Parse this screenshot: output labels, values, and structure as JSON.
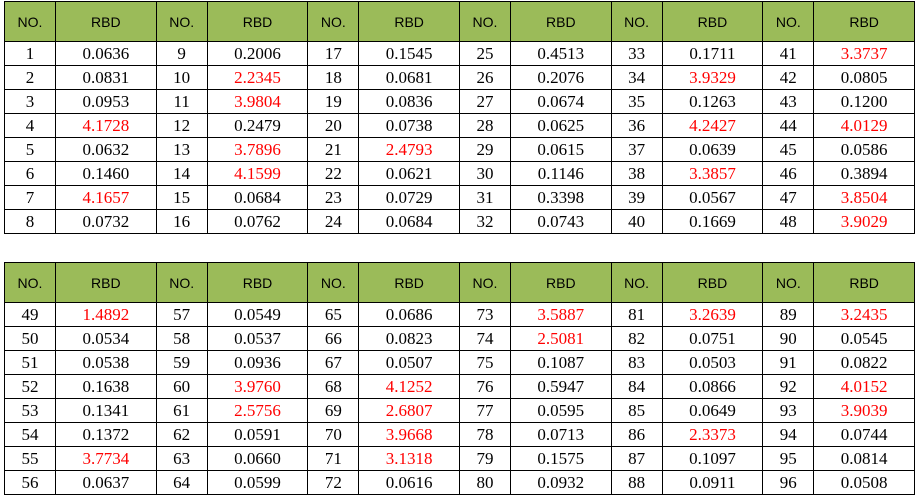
{
  "tables": [
    {
      "headers": [
        "NO.",
        "RBD",
        "NO.",
        "RBD",
        "NO.",
        "RBD",
        "NO.",
        "RBD",
        "NO.",
        "RBD",
        "NO.",
        "RBD"
      ],
      "rows": [
        [
          {
            "no": "1",
            "rbd": "0.0636",
            "hi": false
          },
          {
            "no": "9",
            "rbd": "0.2006",
            "hi": false
          },
          {
            "no": "17",
            "rbd": "0.1545",
            "hi": false
          },
          {
            "no": "25",
            "rbd": "0.4513",
            "hi": false
          },
          {
            "no": "33",
            "rbd": "0.1711",
            "hi": false
          },
          {
            "no": "41",
            "rbd": "3.3737",
            "hi": true
          }
        ],
        [
          {
            "no": "2",
            "rbd": "0.0831",
            "hi": false
          },
          {
            "no": "10",
            "rbd": "2.2345",
            "hi": true
          },
          {
            "no": "18",
            "rbd": "0.0681",
            "hi": false
          },
          {
            "no": "26",
            "rbd": "0.2076",
            "hi": false
          },
          {
            "no": "34",
            "rbd": "3.9329",
            "hi": true
          },
          {
            "no": "42",
            "rbd": "0.0805",
            "hi": false
          }
        ],
        [
          {
            "no": "3",
            "rbd": "0.0953",
            "hi": false
          },
          {
            "no": "11",
            "rbd": "3.9804",
            "hi": true
          },
          {
            "no": "19",
            "rbd": "0.0836",
            "hi": false
          },
          {
            "no": "27",
            "rbd": "0.0674",
            "hi": false
          },
          {
            "no": "35",
            "rbd": "0.1263",
            "hi": false
          },
          {
            "no": "43",
            "rbd": "0.1200",
            "hi": false
          }
        ],
        [
          {
            "no": "4",
            "rbd": "4.1728",
            "hi": true
          },
          {
            "no": "12",
            "rbd": "0.2479",
            "hi": false
          },
          {
            "no": "20",
            "rbd": "0.0738",
            "hi": false
          },
          {
            "no": "28",
            "rbd": "0.0625",
            "hi": false
          },
          {
            "no": "36",
            "rbd": "4.2427",
            "hi": true
          },
          {
            "no": "44",
            "rbd": "4.0129",
            "hi": true
          }
        ],
        [
          {
            "no": "5",
            "rbd": "0.0632",
            "hi": false
          },
          {
            "no": "13",
            "rbd": "3.7896",
            "hi": true
          },
          {
            "no": "21",
            "rbd": "2.4793",
            "hi": true
          },
          {
            "no": "29",
            "rbd": "0.0615",
            "hi": false
          },
          {
            "no": "37",
            "rbd": "0.0639",
            "hi": false
          },
          {
            "no": "45",
            "rbd": "0.0586",
            "hi": false
          }
        ],
        [
          {
            "no": "6",
            "rbd": "0.1460",
            "hi": false
          },
          {
            "no": "14",
            "rbd": "4.1599",
            "hi": true
          },
          {
            "no": "22",
            "rbd": "0.0621",
            "hi": false
          },
          {
            "no": "30",
            "rbd": "0.1146",
            "hi": false
          },
          {
            "no": "38",
            "rbd": "3.3857",
            "hi": true
          },
          {
            "no": "46",
            "rbd": "0.3894",
            "hi": false
          }
        ],
        [
          {
            "no": "7",
            "rbd": "4.1657",
            "hi": true
          },
          {
            "no": "15",
            "rbd": "0.0684",
            "hi": false
          },
          {
            "no": "23",
            "rbd": "0.0729",
            "hi": false
          },
          {
            "no": "31",
            "rbd": "0.3398",
            "hi": false
          },
          {
            "no": "39",
            "rbd": "0.0567",
            "hi": false
          },
          {
            "no": "47",
            "rbd": "3.8504",
            "hi": true
          }
        ],
        [
          {
            "no": "8",
            "rbd": "0.0732",
            "hi": false
          },
          {
            "no": "16",
            "rbd": "0.0762",
            "hi": false
          },
          {
            "no": "24",
            "rbd": "0.0684",
            "hi": false
          },
          {
            "no": "32",
            "rbd": "0.0743",
            "hi": false
          },
          {
            "no": "40",
            "rbd": "0.1669",
            "hi": false
          },
          {
            "no": "48",
            "rbd": "3.9029",
            "hi": true
          }
        ]
      ]
    },
    {
      "headers": [
        "NO.",
        "RBD",
        "NO.",
        "RBD",
        "NO.",
        "RBD",
        "NO.",
        "RBD",
        "NO.",
        "RBD",
        "NO.",
        "RBD"
      ],
      "rows": [
        [
          {
            "no": "49",
            "rbd": "1.4892",
            "hi": true
          },
          {
            "no": "57",
            "rbd": "0.0549",
            "hi": false
          },
          {
            "no": "65",
            "rbd": "0.0686",
            "hi": false
          },
          {
            "no": "73",
            "rbd": "3.5887",
            "hi": true
          },
          {
            "no": "81",
            "rbd": "3.2639",
            "hi": true
          },
          {
            "no": "89",
            "rbd": "3.2435",
            "hi": true
          }
        ],
        [
          {
            "no": "50",
            "rbd": "0.0534",
            "hi": false
          },
          {
            "no": "58",
            "rbd": "0.0537",
            "hi": false
          },
          {
            "no": "66",
            "rbd": "0.0823",
            "hi": false
          },
          {
            "no": "74",
            "rbd": "2.5081",
            "hi": true
          },
          {
            "no": "82",
            "rbd": "0.0751",
            "hi": false
          },
          {
            "no": "90",
            "rbd": "0.0545",
            "hi": false
          }
        ],
        [
          {
            "no": "51",
            "rbd": "0.0538",
            "hi": false
          },
          {
            "no": "59",
            "rbd": "0.0936",
            "hi": false
          },
          {
            "no": "67",
            "rbd": "0.0507",
            "hi": false
          },
          {
            "no": "75",
            "rbd": "0.1087",
            "hi": false
          },
          {
            "no": "83",
            "rbd": "0.0503",
            "hi": false
          },
          {
            "no": "91",
            "rbd": "0.0822",
            "hi": false
          }
        ],
        [
          {
            "no": "52",
            "rbd": "0.1638",
            "hi": false
          },
          {
            "no": "60",
            "rbd": "3.9760",
            "hi": true
          },
          {
            "no": "68",
            "rbd": "4.1252",
            "hi": true
          },
          {
            "no": "76",
            "rbd": "0.5947",
            "hi": false
          },
          {
            "no": "84",
            "rbd": "0.0866",
            "hi": false
          },
          {
            "no": "92",
            "rbd": "4.0152",
            "hi": true
          }
        ],
        [
          {
            "no": "53",
            "rbd": "0.1341",
            "hi": false
          },
          {
            "no": "61",
            "rbd": "2.5756",
            "hi": true
          },
          {
            "no": "69",
            "rbd": "2.6807",
            "hi": true
          },
          {
            "no": "77",
            "rbd": "0.0595",
            "hi": false
          },
          {
            "no": "85",
            "rbd": "0.0649",
            "hi": false
          },
          {
            "no": "93",
            "rbd": "3.9039",
            "hi": true
          }
        ],
        [
          {
            "no": "54",
            "rbd": "0.1372",
            "hi": false
          },
          {
            "no": "62",
            "rbd": "0.0591",
            "hi": false
          },
          {
            "no": "70",
            "rbd": "3.9668",
            "hi": true
          },
          {
            "no": "78",
            "rbd": "0.0713",
            "hi": false
          },
          {
            "no": "86",
            "rbd": "2.3373",
            "hi": true
          },
          {
            "no": "94",
            "rbd": "0.0744",
            "hi": false
          }
        ],
        [
          {
            "no": "55",
            "rbd": "3.7734",
            "hi": true
          },
          {
            "no": "63",
            "rbd": "0.0660",
            "hi": false
          },
          {
            "no": "71",
            "rbd": "3.1318",
            "hi": true
          },
          {
            "no": "79",
            "rbd": "0.1575",
            "hi": false
          },
          {
            "no": "87",
            "rbd": "0.1097",
            "hi": false
          },
          {
            "no": "95",
            "rbd": "0.0814",
            "hi": false
          }
        ],
        [
          {
            "no": "56",
            "rbd": "0.0637",
            "hi": false
          },
          {
            "no": "64",
            "rbd": "0.0599",
            "hi": false
          },
          {
            "no": "72",
            "rbd": "0.0616",
            "hi": false
          },
          {
            "no": "80",
            "rbd": "0.0932",
            "hi": false
          },
          {
            "no": "88",
            "rbd": "0.0911",
            "hi": false
          },
          {
            "no": "96",
            "rbd": "0.0508",
            "hi": false
          }
        ]
      ]
    }
  ]
}
